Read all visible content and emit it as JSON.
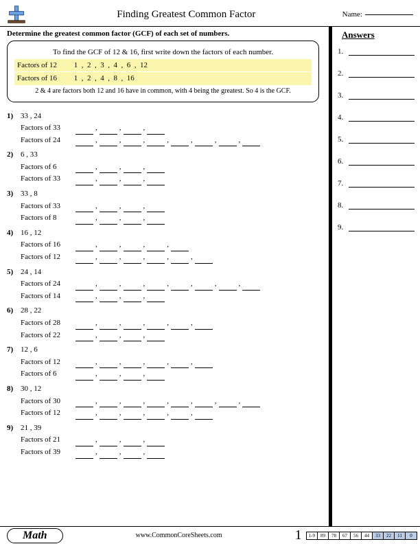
{
  "header": {
    "title": "Finding Greatest Common Factor",
    "name_label": "Name:"
  },
  "instruction": "Determine the greatest common factor (GCF) of each set of numbers.",
  "example": {
    "intro": "To find the GCF of 12 & 16, first write down the factors of each number.",
    "line1_label": "Factors of 12",
    "line1_values": "1  ,  2  ,  3  ,  4  ,  6  ,  12",
    "line2_label": "Factors of 16",
    "line2_values": "1  ,  2  ,  4  ,  8  ,  16",
    "conclusion": "2 & 4 are factors both 12 and 16 have in common, with 4 being the greatest. So 4 is the GCF."
  },
  "questions": [
    {
      "n": "1)",
      "pair": "33 , 24",
      "fa_label": "Factors of 33",
      "fa_blanks": 4,
      "fb_label": "Factors of 24",
      "fb_blanks": 8
    },
    {
      "n": "2)",
      "pair": "6 , 33",
      "fa_label": "Factors of 6",
      "fa_blanks": 4,
      "fb_label": "Factors of 33",
      "fb_blanks": 4
    },
    {
      "n": "3)",
      "pair": "33 , 8",
      "fa_label": "Factors of 33",
      "fa_blanks": 4,
      "fb_label": "Factors of 8",
      "fb_blanks": 4
    },
    {
      "n": "4)",
      "pair": "16 , 12",
      "fa_label": "Factors of 16",
      "fa_blanks": 5,
      "fb_label": "Factors of 12",
      "fb_blanks": 6
    },
    {
      "n": "5)",
      "pair": "24 , 14",
      "fa_label": "Factors of 24",
      "fa_blanks": 8,
      "fb_label": "Factors of 14",
      "fb_blanks": 4
    },
    {
      "n": "6)",
      "pair": "28 , 22",
      "fa_label": "Factors of 28",
      "fa_blanks": 6,
      "fb_label": "Factors of 22",
      "fb_blanks": 4
    },
    {
      "n": "7)",
      "pair": "12 , 6",
      "fa_label": "Factors of 12",
      "fa_blanks": 6,
      "fb_label": "Factors of 6",
      "fb_blanks": 4
    },
    {
      "n": "8)",
      "pair": "30 , 12",
      "fa_label": "Factors of 30",
      "fa_blanks": 8,
      "fb_label": "Factors of 12",
      "fb_blanks": 6
    },
    {
      "n": "9)",
      "pair": "21 , 39",
      "fa_label": "Factors of 21",
      "fa_blanks": 4,
      "fb_label": "Factors of 39",
      "fb_blanks": 4
    }
  ],
  "answers": {
    "title": "Answers",
    "count": 9
  },
  "footer": {
    "subject": "Math",
    "site": "www.CommonCoreSheets.com",
    "page": "1",
    "scale_label": "1-9",
    "scale": [
      "89",
      "78",
      "67",
      "56",
      "44",
      "33",
      "22",
      "11",
      "0"
    ],
    "scale_colors": [
      "#ffffff",
      "#ffffff",
      "#ffffff",
      "#ffffff",
      "#ffffff",
      "#b9cde8",
      "#b9cde8",
      "#b9cde8",
      "#b9cde8"
    ]
  }
}
